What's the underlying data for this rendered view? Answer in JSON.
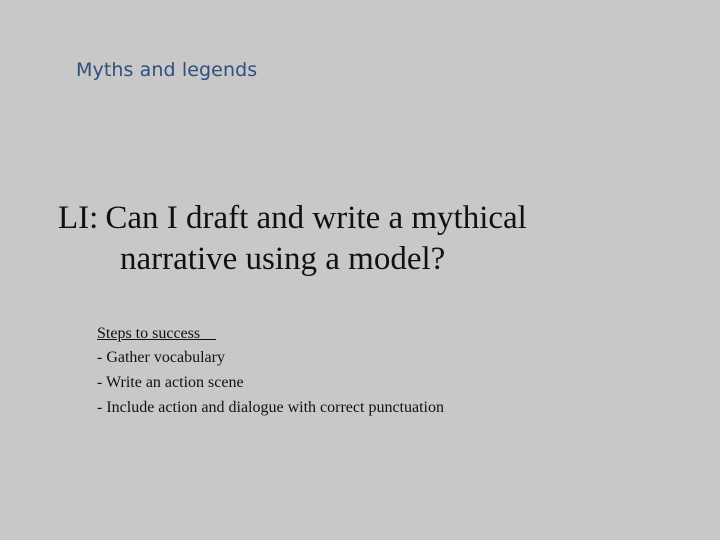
{
  "slide": {
    "subtitle": "Myths and legends",
    "objective": {
      "prefix": "LI:",
      "line1_text": "Can I draft and write a mythical",
      "line2_text": "narrative using a model?"
    },
    "steps": {
      "heading": "Steps to success    ",
      "items": [
        "- Gather vocabulary",
        "- Write an action scene",
        "- Include action and dialogue with correct punctuation"
      ]
    }
  }
}
